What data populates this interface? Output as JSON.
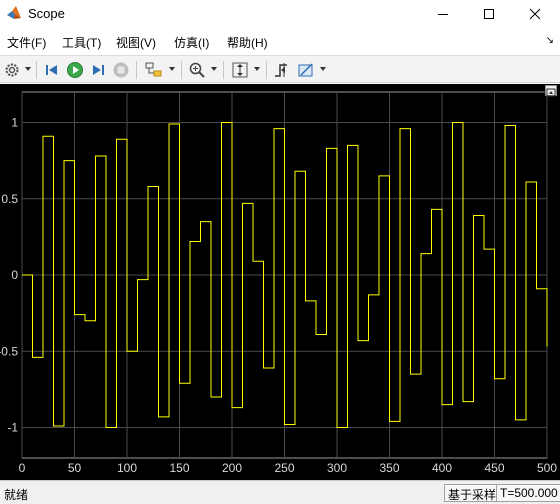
{
  "window": {
    "title": "Scope"
  },
  "menu": [
    {
      "label": "文件(F)"
    },
    {
      "label": "工具(T)"
    },
    {
      "label": "视图(V)"
    },
    {
      "label": "仿真(I)"
    },
    {
      "label": "帮助(H)"
    }
  ],
  "toolbar": {
    "icons": [
      "settings-icon",
      "step-back-icon",
      "run-icon",
      "step-forward-icon",
      "stop-icon",
      "highlight-block-icon",
      "zoom-icon",
      "autoscale-icon",
      "triggers-icon",
      "measurements-icon"
    ]
  },
  "chart_data": {
    "type": "line",
    "style": "stairs",
    "background": "#000000",
    "line_color": "#ffff00",
    "grid": true,
    "xlim": [
      0,
      500
    ],
    "ylim": [
      -1.2,
      1.2
    ],
    "xticks": [
      "0",
      "50",
      "100",
      "150",
      "200",
      "250",
      "300",
      "350",
      "400",
      "450",
      "500"
    ],
    "yticks": [
      "1",
      "0.5",
      "0",
      "-0.5",
      "-1"
    ],
    "x": [
      0,
      10,
      20,
      30,
      40,
      50,
      60,
      70,
      80,
      90,
      100,
      110,
      120,
      130,
      140,
      150,
      160,
      170,
      180,
      190,
      200,
      210,
      220,
      230,
      240,
      250,
      260,
      270,
      280,
      290,
      300,
      310,
      320,
      330,
      340,
      350,
      360,
      370,
      380,
      390,
      400,
      410,
      420,
      430,
      440,
      450,
      460,
      470,
      480,
      490,
      500
    ],
    "values": [
      0.0,
      -0.54,
      0.91,
      -0.99,
      0.75,
      -0.26,
      -0.3,
      0.78,
      -1.0,
      0.89,
      -0.5,
      -0.03,
      0.58,
      -0.93,
      0.99,
      -0.71,
      0.22,
      0.35,
      -0.8,
      1.0,
      -0.87,
      0.47,
      0.09,
      -0.61,
      0.96,
      -0.98,
      0.68,
      -0.17,
      -0.39,
      0.83,
      -1.0,
      0.85,
      -0.43,
      -0.13,
      0.65,
      -0.96,
      0.96,
      -0.65,
      0.14,
      0.43,
      -0.85,
      1.0,
      -0.83,
      0.39,
      0.17,
      -0.68,
      0.98,
      -0.95,
      0.61,
      -0.09,
      -0.47
    ]
  },
  "status": {
    "left": "就绪",
    "mode": "基于采样",
    "time": "T=500.000"
  }
}
